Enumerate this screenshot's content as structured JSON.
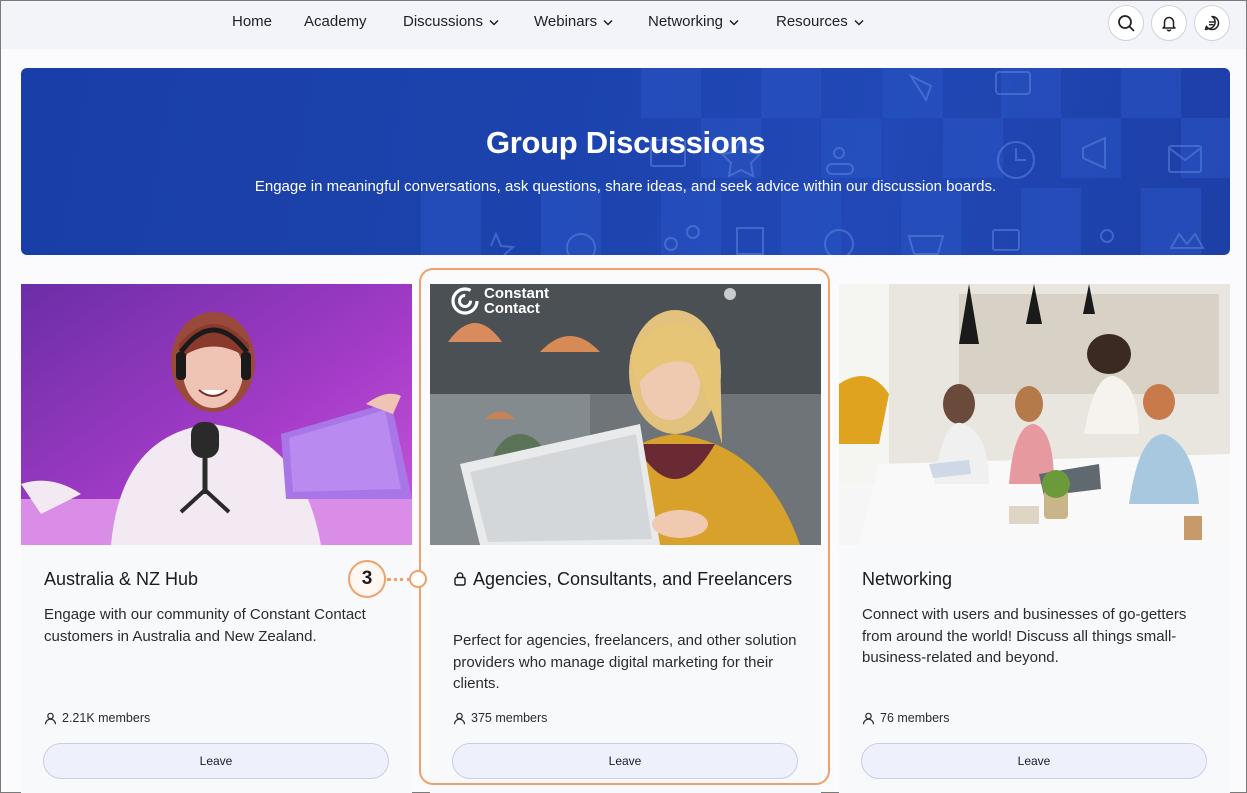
{
  "nav": {
    "items": [
      {
        "label": "Home",
        "has_dropdown": false
      },
      {
        "label": "Academy",
        "has_dropdown": false
      },
      {
        "label": "Discussions",
        "has_dropdown": true
      },
      {
        "label": "Webinars",
        "has_dropdown": true
      },
      {
        "label": "Networking",
        "has_dropdown": true
      },
      {
        "label": "Resources",
        "has_dropdown": true
      }
    ],
    "icons": [
      "search-icon",
      "bell-icon",
      "chat-icon"
    ]
  },
  "hero": {
    "title": "Group Discussions",
    "subtitle": "Engage in meaningful conversations, ask questions, share ideas, and seek advice within our discussion boards."
  },
  "cards": [
    {
      "title": "Australia & NZ Hub",
      "locked": false,
      "description": "Engage with our community of Constant Contact customers in Australia and New Zealand.",
      "members": "2.21K members",
      "button": "Leave"
    },
    {
      "title": "Agencies, Consultants, and Freelancers",
      "locked": true,
      "logo_text": "Constant\nContact",
      "description": "Perfect for agencies, freelancers, and other solution providers who manage digital marketing for their clients.",
      "members": "375 members",
      "button": "Leave"
    },
    {
      "title": "Networking",
      "locked": false,
      "description": "Connect with users and businesses of go-getters from around the world! Discuss all things small-business-related and beyond.",
      "members": "76 members",
      "button": "Leave"
    }
  ],
  "callout": {
    "step": "3"
  },
  "colors": {
    "hero_blue": "#1c43ad",
    "highlight_orange": "#f0a06a",
    "button_bg": "#eef1fb"
  }
}
